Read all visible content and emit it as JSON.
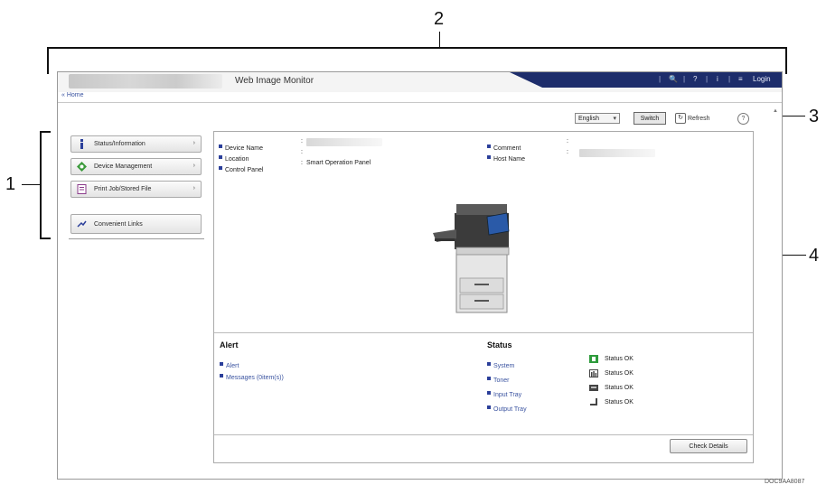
{
  "callouts": {
    "c1": "1",
    "c2": "2",
    "c3": "3",
    "c4": "4"
  },
  "header": {
    "title": "Web Image Monitor",
    "search_glyph": "🔍",
    "help_glyph": "?",
    "info_glyph": "i",
    "menu_glyph": "≡",
    "login": "Login"
  },
  "breadcrumb": "« Home",
  "toolbar": {
    "language": "English",
    "switch": "Switch",
    "refresh": "Refresh",
    "help_glyph": "?"
  },
  "sidebar": {
    "items": [
      {
        "label": "Status/Information",
        "arrow": "›"
      },
      {
        "label": "Device Management",
        "arrow": "›"
      },
      {
        "label": "Print Job/Stored File",
        "arrow": "›"
      },
      {
        "label": "Convenient Links"
      }
    ]
  },
  "info": {
    "device_name": "Device Name",
    "location": "Location",
    "control_panel": "Control Panel",
    "control_panel_value": "Smart Operation Panel",
    "comment": "Comment",
    "host_name": "Host Name",
    "colon": ":"
  },
  "alert": {
    "title": "Alert",
    "links": [
      "Alert",
      "Messages (0item(s))"
    ]
  },
  "status": {
    "title": "Status",
    "rows": [
      {
        "label": "System",
        "icon": "system-icon",
        "value": "Status OK"
      },
      {
        "label": "Toner",
        "icon": "toner-icon",
        "value": "Status OK"
      },
      {
        "label": "Input Tray",
        "icon": "input-tray-icon",
        "value": "Status OK"
      },
      {
        "label": "Output Tray",
        "icon": "output-tray-icon",
        "value": "Status OK"
      }
    ]
  },
  "check_details": "Check Details",
  "doc_code": "DOC9AA8087",
  "colors": {
    "accent": "#1d2d6b",
    "link": "#3a53a0",
    "status_ok": "#2e9b3c"
  }
}
